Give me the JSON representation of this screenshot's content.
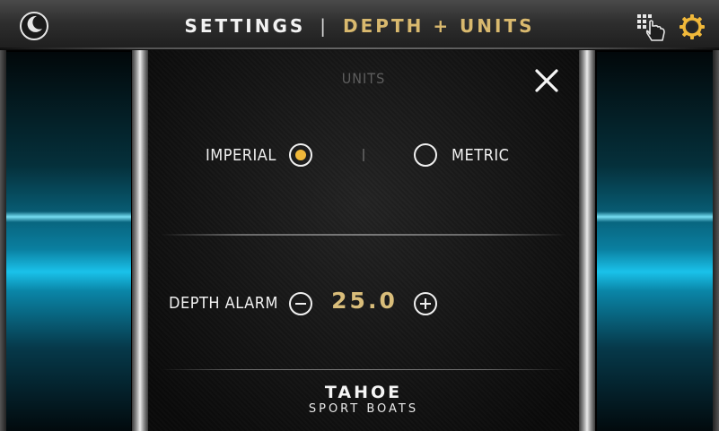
{
  "header": {
    "title_main": "SETTINGS",
    "separator": "|",
    "title_sub": "DEPTH + UNITS",
    "accent_color": "#d9b96e",
    "left_icon": "moon-icon",
    "right_icons": [
      "touch-keypad-icon",
      "gear-icon"
    ]
  },
  "units": {
    "heading": "UNITS",
    "close_icon": "close-icon",
    "options": [
      {
        "label": "IMPERIAL",
        "selected": true
      },
      {
        "label": "METRIC",
        "selected": false
      }
    ],
    "selected_color": "#f0b83a"
  },
  "depth_alarm": {
    "label": "DEPTH ALARM",
    "value": "25.0",
    "decrement_icon": "minus-icon",
    "increment_icon": "plus-icon"
  },
  "logo": {
    "main": "TAHOE",
    "sub": "SPORT BOATS"
  }
}
